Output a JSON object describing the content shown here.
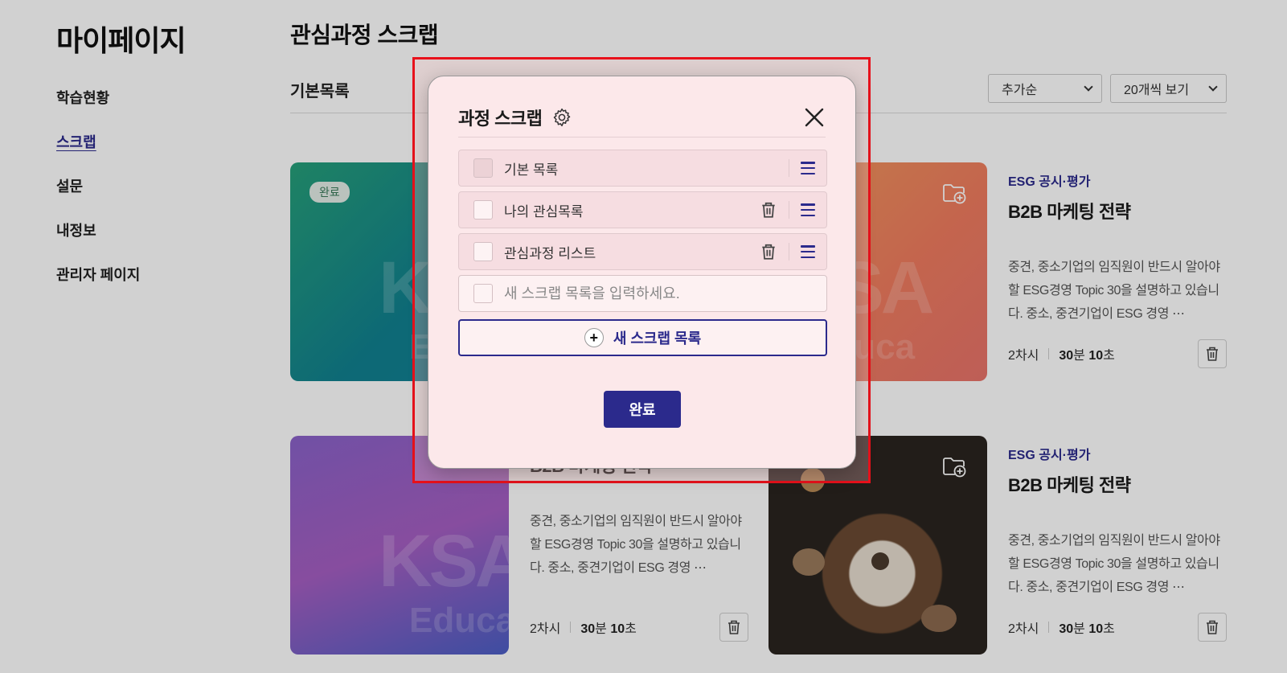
{
  "sidebar": {
    "title": "마이페이지",
    "items": [
      {
        "label": "학습현황"
      },
      {
        "label": "스크랩"
      },
      {
        "label": "설문"
      },
      {
        "label": "내정보"
      },
      {
        "label": "관리자 페이지"
      }
    ]
  },
  "main": {
    "title": "관심과정 스크랩",
    "list_name": "기본목록",
    "sort_select": "추가순",
    "per_page_select": "20개씩 보기"
  },
  "cards": [
    {
      "badge": "완료",
      "watermark": "KSA",
      "watermark2": "Edu",
      "category": "",
      "title": "",
      "desc": "",
      "sessions": "",
      "time_num1": "",
      "time_unit1": "",
      "time_num2": "",
      "time_unit2": ""
    },
    {
      "watermark": "KSA",
      "watermark2": "Educa",
      "category": "ESG 공시·평가",
      "title": "B2B 마케팅 전략",
      "desc": "중견, 중소기업의 임직원이 반드시 알아야 할 ESG경영 Topic 30을 설명하고 있습니다. 중소, 중견기업이 ESG 경영 ⋯",
      "sessions": "2차시",
      "time_num1": "30",
      "time_unit1": "분",
      "time_num2": "10",
      "time_unit2": "초"
    },
    {
      "watermark": "KSA",
      "watermark2": "Educa",
      "category": "",
      "title": "B2B 마케팅 전략",
      "desc": "중견, 중소기업의 임직원이 반드시 알아야 할 ESG경영 Topic 30을 설명하고 있습니다. 중소, 중견기업이 ESG 경영 ⋯",
      "sessions": "2차시",
      "time_num1": "30",
      "time_unit1": "분",
      "time_num2": "10",
      "time_unit2": "초"
    },
    {
      "category": "ESG 공시·평가",
      "title": "B2B 마케팅 전략",
      "desc": "중견, 중소기업의 임직원이 반드시 알아야 할 ESG경영 Topic 30을 설명하고 있습니다. 중소, 중견기업이 ESG 경영 ⋯",
      "sessions": "2차시",
      "time_num1": "30",
      "time_unit1": "분",
      "time_num2": "10",
      "time_unit2": "초"
    }
  ],
  "modal": {
    "title": "과정 스크랩",
    "lists": [
      {
        "label": "기본 목록"
      },
      {
        "label": "나의 관심목록"
      },
      {
        "label": "관심과정 리스트"
      }
    ],
    "new_list_placeholder": "새 스크랩 목록을 입력하세요.",
    "add_button": "새 스크랩 목록",
    "done_button": "완료"
  },
  "colors": {
    "accent": "#2b2a8c",
    "highlight_border": "#e8111b",
    "modal_bg": "#fce8ea"
  },
  "icons": [
    "gear-icon",
    "close-icon",
    "trash-icon",
    "drag-handle-icon",
    "plus-icon",
    "folder-add-icon",
    "chevron-down-icon"
  ]
}
